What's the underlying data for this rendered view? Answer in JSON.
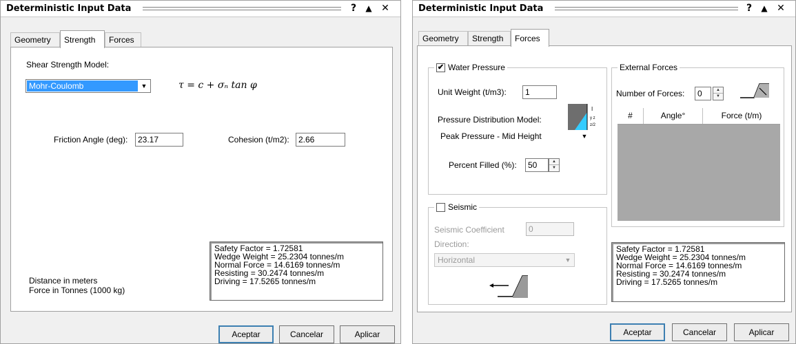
{
  "left_dialog": {
    "title": "Deterministic Input Data",
    "help_btn": "?",
    "collapse_btn": "▲",
    "close_btn": "✕",
    "tabs": [
      "Geometry",
      "Strength",
      "Forces"
    ],
    "active_tab": "Strength",
    "shear_model_label": "Shear Strength Model:",
    "shear_model_value": "Mohr-Coulomb",
    "formula": "τ = c + σₙ tan φ",
    "friction_label": "Friction Angle (deg):",
    "friction_value": "23.17",
    "cohesion_label": "Cohesion (t/m2):",
    "cohesion_value": "2.66",
    "units": [
      "Distance in meters",
      "Force in Tonnes (1000 kg)"
    ],
    "results": [
      "Safety Factor = 1.72581",
      "Wedge Weight = 25.2304 tonnes/m",
      "Normal Force = 14.6169 tonnes/m",
      "Resisting = 30.2474 tonnes/m",
      "Driving = 17.5265 tonnes/m"
    ],
    "buttons": {
      "ok": "Aceptar",
      "cancel": "Cancelar",
      "apply": "Aplicar"
    }
  },
  "right_dialog": {
    "title": "Deterministic Input Data",
    "help_btn": "?",
    "collapse_btn": "▲",
    "close_btn": "✕",
    "tabs": [
      "Geometry",
      "Strength",
      "Forces"
    ],
    "active_tab": "Forces",
    "water": {
      "title": "Water Pressure",
      "checked": true,
      "check_mark": "✔",
      "unit_weight_label": "Unit Weight (t/m3):",
      "unit_weight_value": "1",
      "dist_model_label": "Pressure Distribution Model:",
      "dist_model_value": "Peak Pressure - Mid Height",
      "percent_label": "Percent Filled (%):",
      "percent_value": "50"
    },
    "seismic": {
      "title": "Seismic",
      "checked": false,
      "coef_label": "Seismic Coefficient",
      "coef_value": "0",
      "direction_label": "Direction:",
      "direction_value": "Horizontal"
    },
    "external": {
      "title": "External Forces",
      "count_label": "Number of Forces:",
      "count_value": "0",
      "columns": [
        "#",
        "Angle°",
        "Force (t/m)"
      ]
    },
    "results": [
      "Safety Factor = 1.72581",
      "Wedge Weight = 25.2304 tonnes/m",
      "Normal Force = 14.6169 tonnes/m",
      "Resisting = 30.2474 tonnes/m",
      "Driving = 17.5265 tonnes/m"
    ],
    "buttons": {
      "ok": "Aceptar",
      "cancel": "Cancelar",
      "apply": "Aplicar"
    }
  },
  "colors": {
    "accent": "#3399ff",
    "water": "#33ccff",
    "disabled_text": "#9a9a9a",
    "panel_bg": "#f0f0f0"
  }
}
